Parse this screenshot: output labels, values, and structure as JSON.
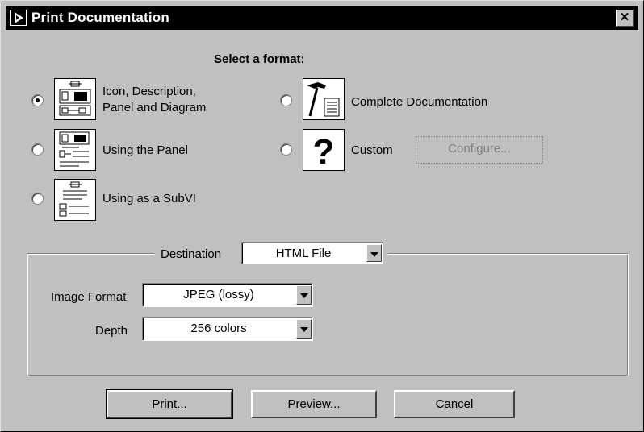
{
  "window": {
    "title": "Print Documentation",
    "close_glyph": "✕"
  },
  "heading": "Select a format:",
  "formats": [
    {
      "label_line1": "Icon, Description,",
      "label_line2": "Panel and Diagram",
      "icon": "icon-panel-diagram-icon",
      "selected": true
    },
    {
      "label": "Using the Panel",
      "icon": "panel-icon",
      "selected": false
    },
    {
      "label": "Using as a SubVI",
      "icon": "subvi-icon",
      "selected": false
    },
    {
      "label": "Complete Documentation",
      "icon": "hammer-document-icon",
      "selected": false
    },
    {
      "label": "Custom",
      "icon": "question-mark-icon",
      "selected": false
    }
  ],
  "configure_label": "Configure...",
  "destination": {
    "label": "Destination",
    "value": "HTML File"
  },
  "image_format": {
    "label": "Image Format",
    "value": "JPEG (lossy)"
  },
  "depth": {
    "label": "Depth",
    "value": "256 colors"
  },
  "buttons": {
    "print": "Print...",
    "preview": "Preview...",
    "cancel": "Cancel"
  }
}
